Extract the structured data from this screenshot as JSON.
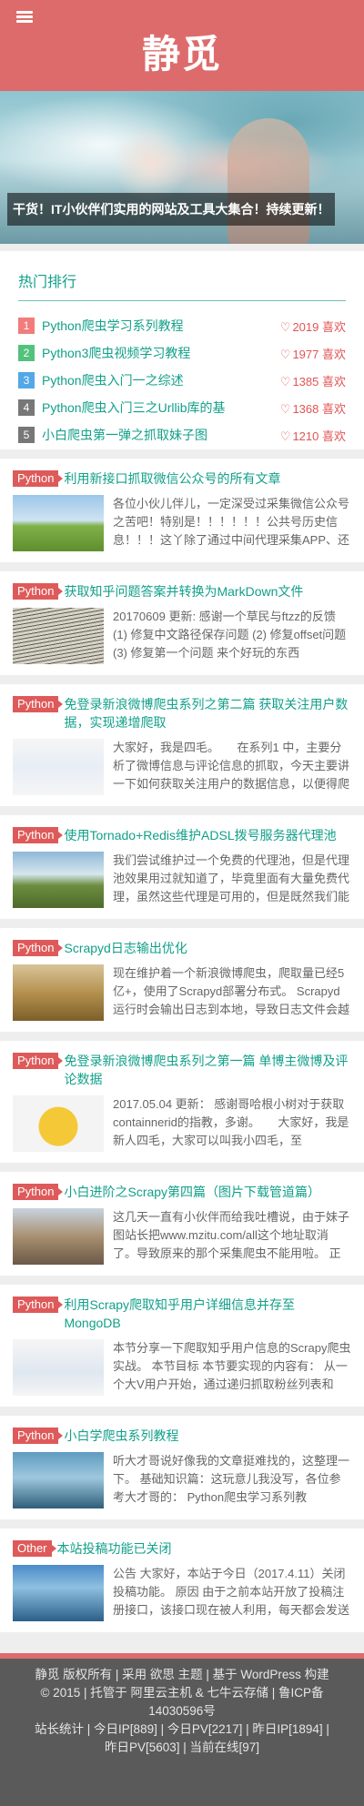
{
  "header": {
    "site_title": "静觅"
  },
  "banner": {
    "caption": "干货！IT小伙伴们实用的网站及工具大集合！持续更新！"
  },
  "hot": {
    "title": "热门排行",
    "items": [
      {
        "num": "1",
        "color": "#f27c7c",
        "title": "Python爬虫学习系列教程",
        "likes": "2019 喜欢"
      },
      {
        "num": "2",
        "color": "#52c27c",
        "title": "Python3爬虫视频学习教程",
        "likes": "1977 喜欢"
      },
      {
        "num": "3",
        "color": "#52a8e8",
        "title": "Python爬虫入门一之综述",
        "likes": "1385 喜欢"
      },
      {
        "num": "4",
        "color": "#777777",
        "title": "Python爬虫入门三之Urllib库的基",
        "likes": "1368 喜欢"
      },
      {
        "num": "5",
        "color": "#777777",
        "title": "小白爬虫第一弹之抓取妹子图",
        "likes": "1210 喜欢"
      }
    ]
  },
  "posts": [
    {
      "tag": "Python",
      "title": "利用新接口抓取微信公众号的所有文章",
      "excerpt": "各位小伙儿伴儿，一定深受过采集微信公众号之苦吧！特别是！！！！！！公共号历史信息！！！这丫除了通过中间代理采集APP、还"
    },
    {
      "tag": "Python",
      "title": "获取知乎问题答案并转换为MarkDown文件",
      "excerpt": "20170609 更新: 感谢一个草民与ftzz的反馈 (1) 修复中文路径保存问题 (2) 修复offset问题 (3) 修复第一个问题 来个好玩的东西"
    },
    {
      "tag": "Python",
      "title": "免登录新浪微博爬虫系列之第二篇 获取关注用户数据，实现递增爬取",
      "excerpt": "大家好，我是四毛。　　在系列1 中，主要分析了微博信息与评论信息的抓取，今天主要讲一下如何获取关注用户的数据信息，以便得爬"
    },
    {
      "tag": "Python",
      "title": "使用Tornado+Redis维护ADSL拨号服务器代理池",
      "excerpt": "我们尝试维护过一个免费的代理池，但是代理池效果用过就知道了，毕竟里面有大量免费代理，虽然这些代理是可用的，但是既然我们能"
    },
    {
      "tag": "Python",
      "title": "Scrapyd日志输出优化",
      "excerpt": "现在维护着一个新浪微博爬虫，爬取量已经5亿+，使用了Scrapyd部署分布式。 Scrapyd运行时会输出日志到本地，导致日志文件会越"
    },
    {
      "tag": "Python",
      "title": "免登录新浪微博爬虫系列之第一篇 单博主微博及评论数据",
      "excerpt": "2017.05.04 更新： 感谢哥哈根小树对于获取containnerid的指教，多谢。　　大家好，我是新人四毛，大家可以叫我小四毛，至"
    },
    {
      "tag": "Python",
      "title": "小白进阶之Scrapy第四篇（图片下载管道篇）",
      "excerpt": "这几天一直有小伙伴而给我吐槽说，由于妹子图站长把www.mzitu.com/all这个地址取消了。导致原来的那个采集爬虫不能用啦。 正"
    },
    {
      "tag": "Python",
      "title": "利用Scrapy爬取知乎用户详细信息并存至MongoDB",
      "excerpt": "本节分享一下爬取知乎用户信息的Scrapy爬虫实战。 本节目标 本节要实现的内容有： 从一个大V用户开始，通过递归抓取粉丝列表和"
    },
    {
      "tag": "Python",
      "title": "小白学爬虫系列教程",
      "excerpt": "听大才哥说好像我的文章挺难找的，这整理一下。 基础知识篇：这玩意儿我没写，各位参考大才哥的： Python爬虫学习系列教"
    },
    {
      "tag": "Other",
      "title": "本站投稿功能已关闭",
      "excerpt": "公告 大家好，本站于今日（2017.4.11）关闭投稿功能。 原因 由于之前本站开放了投稿注册接口，该接口现在被人利用，每天都会发送"
    }
  ],
  "footer": {
    "line1": "静觅 版权所有 | 采用 欲思 主题 | 基于 WordPress 构建",
    "line2": "© 2015 | 托管于 阿里云主机 & 七牛云存储 | 鲁ICP备",
    "line3": "14030596号",
    "line4": "站长统计 | 今日IP[889] | 今日PV[2217] | 昨日IP[1894] |",
    "line5": "昨日PV[5603] | 当前在线[97]"
  }
}
